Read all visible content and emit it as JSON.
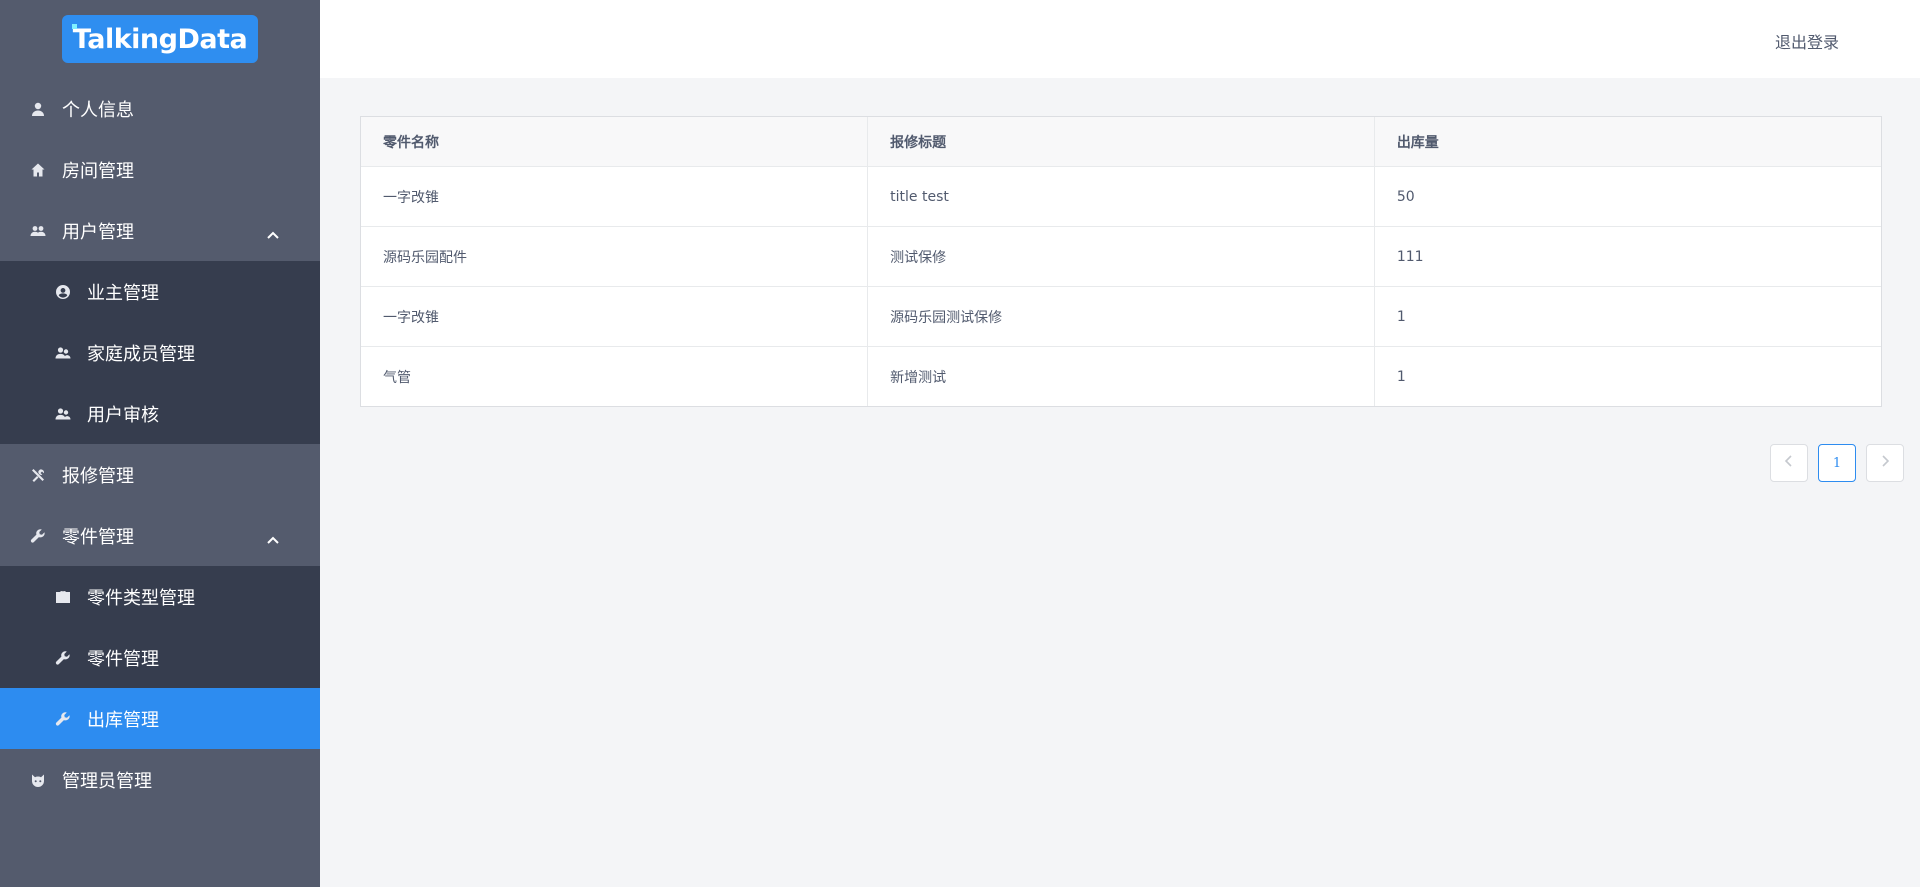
{
  "brand": {
    "logo_text": "TalkingData",
    "accent": "#2d8cf0"
  },
  "header": {
    "logout_label": "退出登录"
  },
  "sidebar": {
    "items": [
      {
        "label": "个人信息",
        "icon": "person-icon"
      },
      {
        "label": "房间管理",
        "icon": "home-icon"
      },
      {
        "label": "用户管理",
        "icon": "people-icon",
        "expanded": true,
        "children": [
          {
            "label": "业主管理",
            "icon": "user-circle-icon"
          },
          {
            "label": "家庭成员管理",
            "icon": "people-icon"
          },
          {
            "label": "用户审核",
            "icon": "people-icon"
          }
        ]
      },
      {
        "label": "报修管理",
        "icon": "tools-icon"
      },
      {
        "label": "零件管理",
        "icon": "wrench-icon",
        "expanded": true,
        "children": [
          {
            "label": "零件类型管理",
            "icon": "briefcase-icon"
          },
          {
            "label": "零件管理",
            "icon": "wrench-icon"
          },
          {
            "label": "出库管理",
            "icon": "wrench-icon",
            "active": true
          }
        ]
      },
      {
        "label": "管理员管理",
        "icon": "admin-icon"
      }
    ]
  },
  "table": {
    "columns": [
      "零件名称",
      "报修标题",
      "出库量"
    ],
    "rows": [
      [
        "一字改锥",
        "title test",
        "50"
      ],
      [
        "源码乐园配件",
        "测试保修",
        "111"
      ],
      [
        "一字改锥",
        "源码乐园测试保修",
        "1"
      ],
      [
        "气管",
        "新增测试",
        "1"
      ]
    ]
  },
  "pagination": {
    "current_page": "1"
  }
}
